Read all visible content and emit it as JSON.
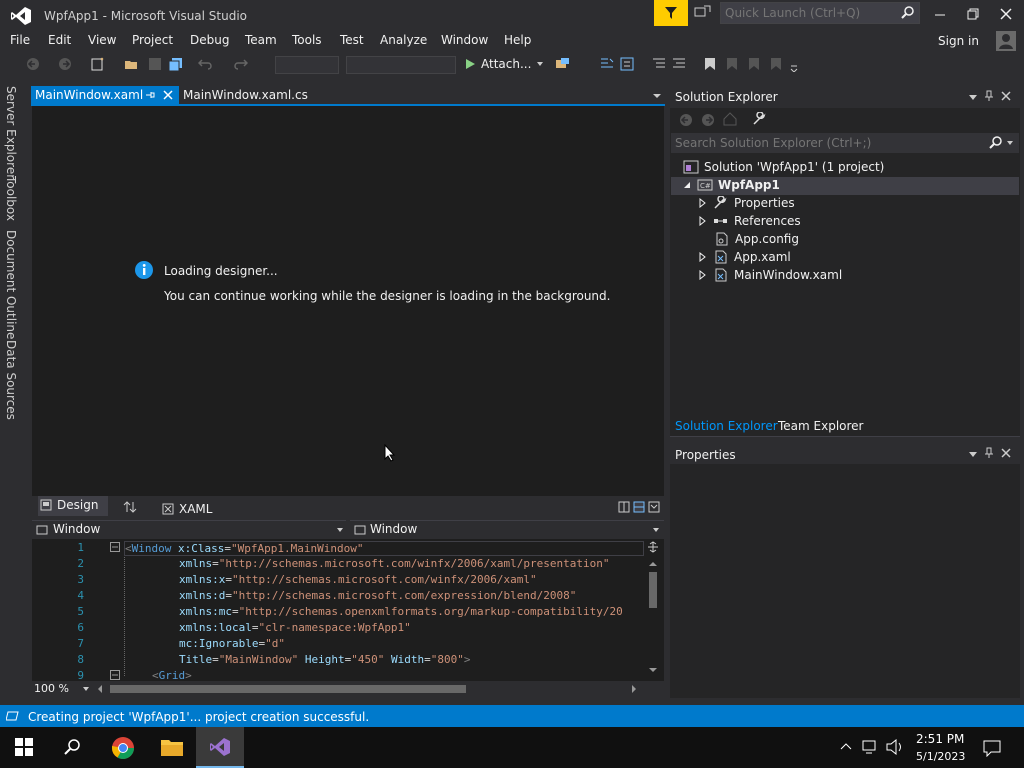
{
  "window": {
    "title": "WpfApp1 - Microsoft Visual Studio",
    "quick_launch_placeholder": "Quick Launch (Ctrl+Q)",
    "sign_in": "Sign in"
  },
  "menu": [
    "File",
    "Edit",
    "View",
    "Project",
    "Debug",
    "Team",
    "Tools",
    "Test",
    "Analyze",
    "Window",
    "Help"
  ],
  "toolbar": {
    "attach_label": "Attach..."
  },
  "left_tabs": [
    "Server Explorer",
    "Toolbox",
    "Document Outline",
    "Data Sources"
  ],
  "doc_tabs": [
    {
      "label": "MainWindow.xaml",
      "active": true
    },
    {
      "label": "MainWindow.xaml.cs",
      "active": false
    }
  ],
  "designer": {
    "loading_title": "Loading designer...",
    "loading_subtitle": "You can continue working while the designer is loading in the background."
  },
  "split": {
    "design_label": "Design",
    "xaml_label": "XAML"
  },
  "nav": {
    "left": "Window",
    "right": "Window"
  },
  "editor": {
    "zoom": "100 %",
    "lines": [
      {
        "n": "1"
      },
      {
        "n": "2"
      },
      {
        "n": "3"
      },
      {
        "n": "4"
      },
      {
        "n": "5"
      },
      {
        "n": "6"
      },
      {
        "n": "7"
      },
      {
        "n": "8"
      },
      {
        "n": "9"
      }
    ],
    "code": {
      "l1_tag": "Window",
      "l1_attr": "x:Class",
      "l1_val": "\"WpfApp1.MainWindow\"",
      "l2_attr": "xmlns",
      "l2_val": "\"http://schemas.microsoft.com/winfx/2006/xaml/presentation\"",
      "l3_attr": "xmlns:x",
      "l3_val": "\"http://schemas.microsoft.com/winfx/2006/xaml\"",
      "l4_attr": "xmlns:d",
      "l4_val": "\"http://schemas.microsoft.com/expression/blend/2008\"",
      "l5_attr": "xmlns:mc",
      "l5_val": "\"http://schemas.openxmlformats.org/markup-compatibility/20",
      "l6_attr": "xmlns:local",
      "l6_val": "\"clr-namespace:WpfApp1\"",
      "l7_attr": "mc:Ignorable",
      "l7_val": "\"d\"",
      "l8_attr_title": "Title",
      "l8_val_title": "\"MainWindow\"",
      "l8_attr_h": "Height",
      "l8_val_h": "\"450\"",
      "l8_attr_w": "Width",
      "l8_val_w": "\"800\"",
      "l9_tag": "Grid"
    }
  },
  "solution_explorer": {
    "title": "Solution Explorer",
    "search_placeholder": "Search Solution Explorer (Ctrl+;)",
    "solution": "Solution 'WpfApp1' (1 project)",
    "project": "WpfApp1",
    "items": [
      "Properties",
      "References",
      "App.config",
      "App.xaml",
      "MainWindow.xaml"
    ],
    "bottom_tabs": [
      "Solution Explorer",
      "Team Explorer"
    ]
  },
  "properties": {
    "title": "Properties"
  },
  "status": {
    "text": "Creating project 'WpfApp1'... project creation successful."
  },
  "taskbar": {
    "time": "2:51 PM",
    "date": "5/1/2023"
  },
  "colors": {
    "accent": "#007acc",
    "background": "#2d2d30",
    "editor": "#1e1e1e",
    "filter": "#ffcc00"
  }
}
